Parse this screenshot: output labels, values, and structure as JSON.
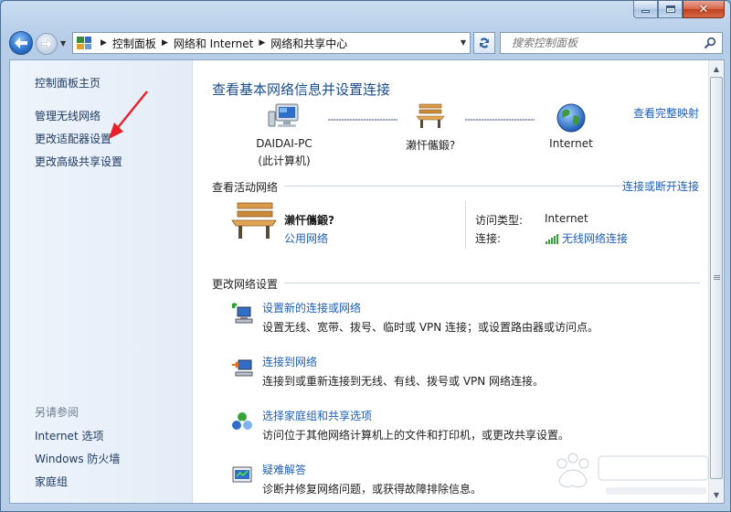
{
  "window": {
    "caption": {
      "close_glyph": "✕"
    }
  },
  "nav": {
    "breadcrumb": [
      "控制面板",
      "网络和 Internet",
      "网络和共享中心"
    ],
    "search_placeholder": "搜索控制面板"
  },
  "sidebar": {
    "items": [
      {
        "label": "控制面板主页"
      },
      {
        "label": "管理无线网络"
      },
      {
        "label": "更改适配器设置"
      },
      {
        "label": "更改高级共享设置"
      }
    ],
    "see_also_title": "另请参阅",
    "see_also": [
      {
        "label": "Internet 选项"
      },
      {
        "label": "Windows 防火墙"
      },
      {
        "label": "家庭组"
      }
    ]
  },
  "main": {
    "help_glyph": "?",
    "title": "查看基本网络信息并设置连接",
    "full_map_link": "查看完整映射",
    "netmap": {
      "computer_name": "DAIDAI-PC",
      "computer_sub": "(此计算机)",
      "network_name": "濑忓儶鍛?",
      "internet_label": "Internet"
    },
    "active": {
      "header": "查看活动网络",
      "connect_link": "连接或断开连接",
      "network_name": "濑忓儶鍛?",
      "network_type": "公用网络",
      "access_type_label": "访问类型:",
      "access_type_value": "Internet",
      "connection_label": "连接:",
      "connection_value": "无线网络连接"
    },
    "change": {
      "header": "更改网络设置",
      "tasks": [
        {
          "link": "设置新的连接或网络",
          "desc": "设置无线、宽带、拨号、临时或 VPN 连接；或设置路由器或访问点。"
        },
        {
          "link": "连接到网络",
          "desc": "连接到或重新连接到无线、有线、拨号或 VPN 网络连接。"
        },
        {
          "link": "选择家庭组和共享选项",
          "desc": "访问位于其他网络计算机上的文件和打印机，或更改共享设置。"
        },
        {
          "link": "疑难解答",
          "desc": "诊断并修复网络问题，或获得故障排除信息。"
        }
      ]
    }
  },
  "colors": {
    "link": "#1e5fb4",
    "title": "#1a4d8a",
    "annotation": "#e8202a"
  }
}
